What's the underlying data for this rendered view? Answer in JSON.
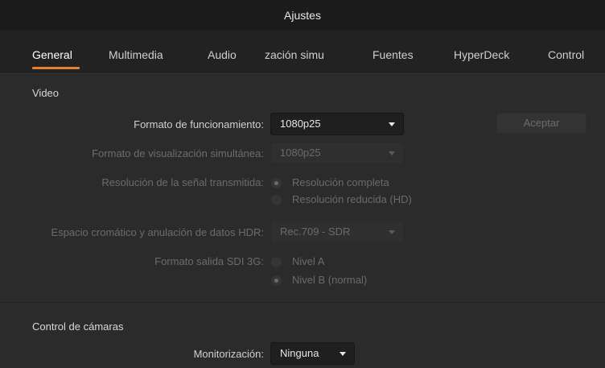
{
  "window": {
    "title": "Ajustes"
  },
  "tabs": [
    {
      "label": "General",
      "active": true
    },
    {
      "label": "Multimedia"
    },
    {
      "label": "Audio"
    },
    {
      "label": "zación simu"
    },
    {
      "label": "Fuentes"
    },
    {
      "label": "HyperDeck"
    },
    {
      "label": "Control"
    }
  ],
  "video": {
    "section_title": "Video",
    "operating_format": {
      "label": "Formato de funcionamiento:",
      "value": "1080p25"
    },
    "accept_label": "Aceptar",
    "multiview_format": {
      "label": "Formato de visualización simultánea:",
      "value": "1080p25"
    },
    "stream_resolution": {
      "label": "Resolución de la señal transmitida:",
      "options": [
        "Resolución completa",
        "Resolución reducida (HD)"
      ],
      "selected": "Resolución completa"
    },
    "color_space": {
      "label": "Espacio cromático y anulación de datos HDR:",
      "value": "Rec.709 - SDR"
    },
    "sdi_format": {
      "label": "Formato salida SDI 3G:",
      "options": [
        "Nivel A",
        "Nivel B (normal)"
      ],
      "selected": "Nivel B (normal)"
    }
  },
  "camera_control": {
    "section_title": "Control de cámaras",
    "monitoring": {
      "label": "Monitorización:",
      "value": "Ninguna"
    }
  },
  "colors": {
    "accent": "#e87f2a",
    "background": "#2b2b2b",
    "tabbar": "#222222",
    "titlebar": "#1c1c1c"
  }
}
